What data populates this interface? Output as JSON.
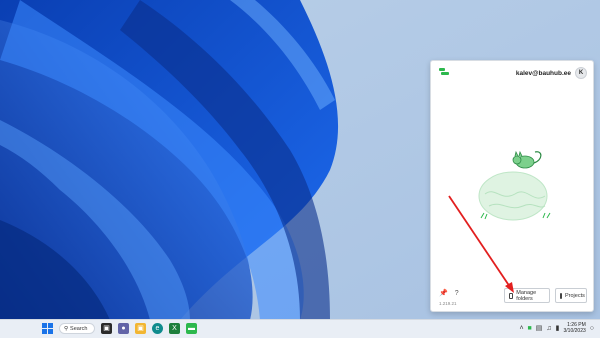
{
  "panel": {
    "user_email": "kalev@bauhub.ee",
    "avatar_initial": "K",
    "version": "1.219.21",
    "manage_folders_label": "Manage folders",
    "projects_label": "Projects",
    "pin_icon": "pin-icon",
    "help_icon": "?",
    "brand_color": "#2db84d"
  },
  "taskbar": {
    "search_label": "Search",
    "time": "1:26 PM",
    "date": "3/10/2023"
  }
}
